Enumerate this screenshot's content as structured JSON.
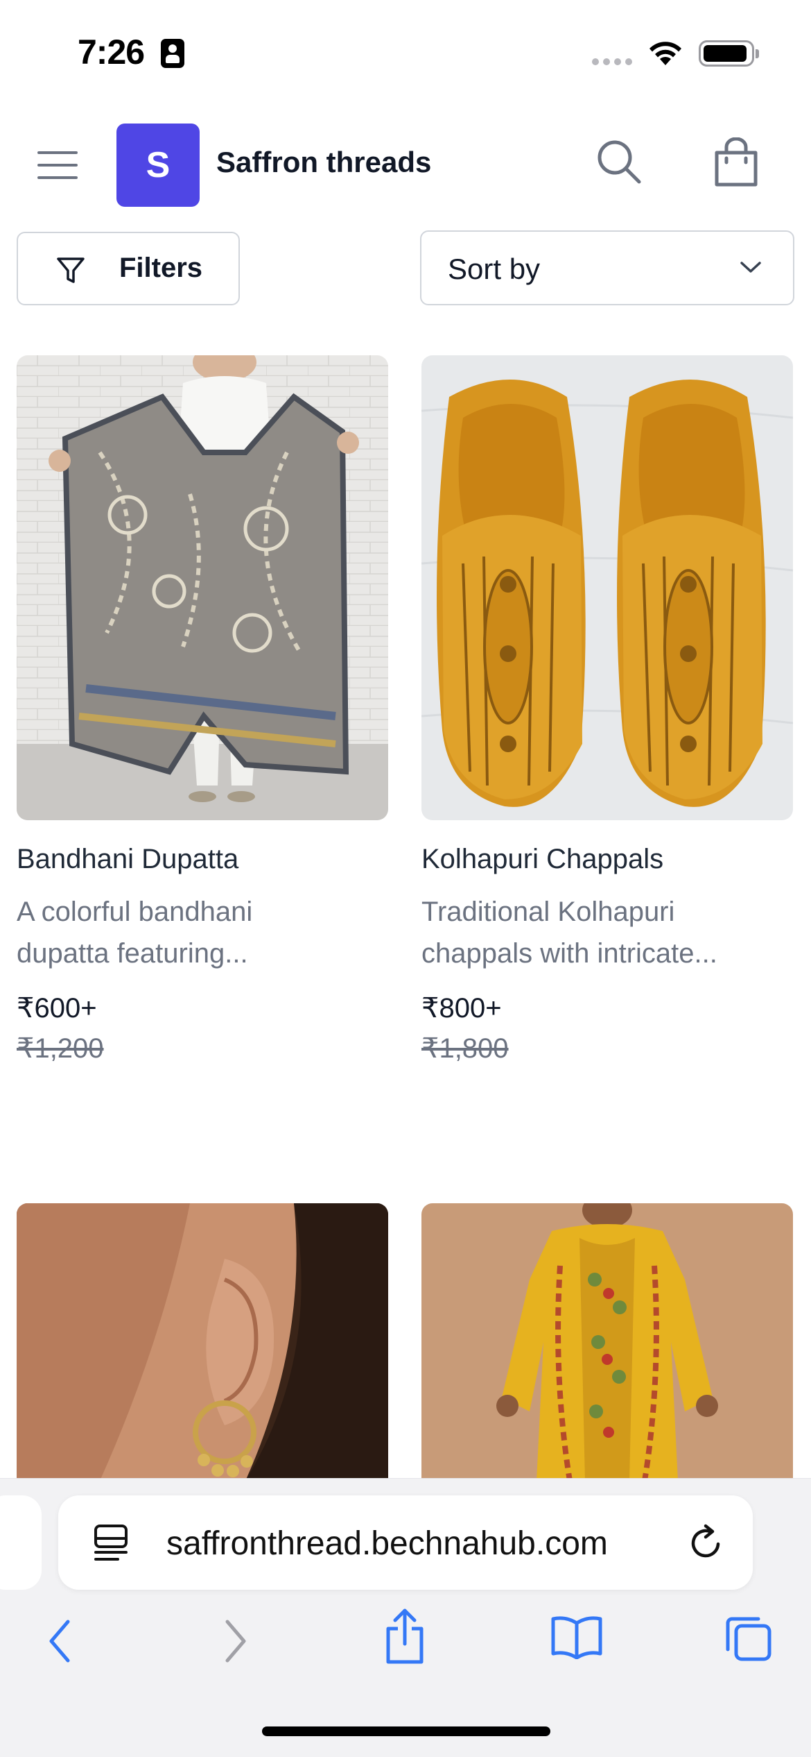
{
  "status_bar": {
    "time": "7:26"
  },
  "header": {
    "logo_letter": "S",
    "store_name": "Saffron threads"
  },
  "toolbar": {
    "filters_label": "Filters",
    "sort_label": "Sort by"
  },
  "products": [
    {
      "title": "Bandhani Dupatta",
      "desc_line1": "A colorful bandhani",
      "desc_line2": "dupatta featuring...",
      "price": "₹600+",
      "mrp": "₹1,200"
    },
    {
      "title": "Kolhapuri Chappals",
      "desc_line1": "Traditional Kolhapuri",
      "desc_line2": "chappals with intricate...",
      "price": "₹800+",
      "mrp": "₹1,800"
    },
    {
      "title": "",
      "desc_line1": "",
      "desc_line2": "",
      "price": "",
      "mrp": ""
    },
    {
      "title": "",
      "desc_line1": "",
      "desc_line2": "",
      "price": "",
      "mrp": ""
    }
  ],
  "browser": {
    "url": "saffronthread.bechnahub.com"
  },
  "colors": {
    "brand": "#4f46e5",
    "browser_accent": "#3478f6"
  },
  "icons": [
    "menu-icon",
    "search-icon",
    "bag-icon",
    "filter-icon",
    "chevron-down-icon",
    "reader-icon",
    "reload-icon",
    "back-icon",
    "forward-icon",
    "share-icon",
    "bookmarks-icon",
    "tabs-icon"
  ]
}
